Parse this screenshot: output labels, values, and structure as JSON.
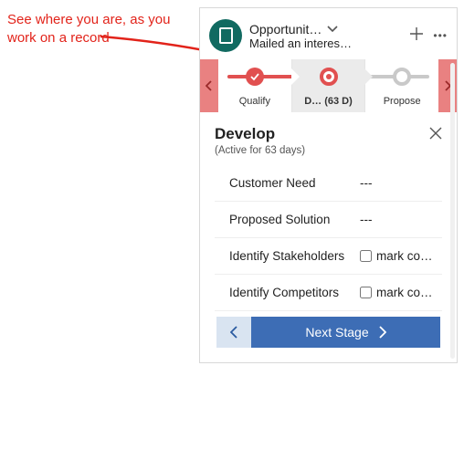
{
  "annotation": "See where you are, as you work on a record",
  "header": {
    "title": "Opportunit…",
    "subtitle": "Mailed an interes…"
  },
  "stages": {
    "s1": "Qualify",
    "s2": "D…  (63 D)",
    "s3": "Propose"
  },
  "flyout": {
    "title": "Develop",
    "subtitle": "(Active for 63 days)",
    "fields": {
      "f1_label": "Customer Need",
      "f1_value": "---",
      "f2_label": "Proposed Solution",
      "f2_value": "---",
      "f3_label": "Identify Stakeholders",
      "f3_check": "mark co…",
      "f4_label": "Identify Competitors",
      "f4_check": "mark co…"
    },
    "next_label": "Next Stage"
  }
}
